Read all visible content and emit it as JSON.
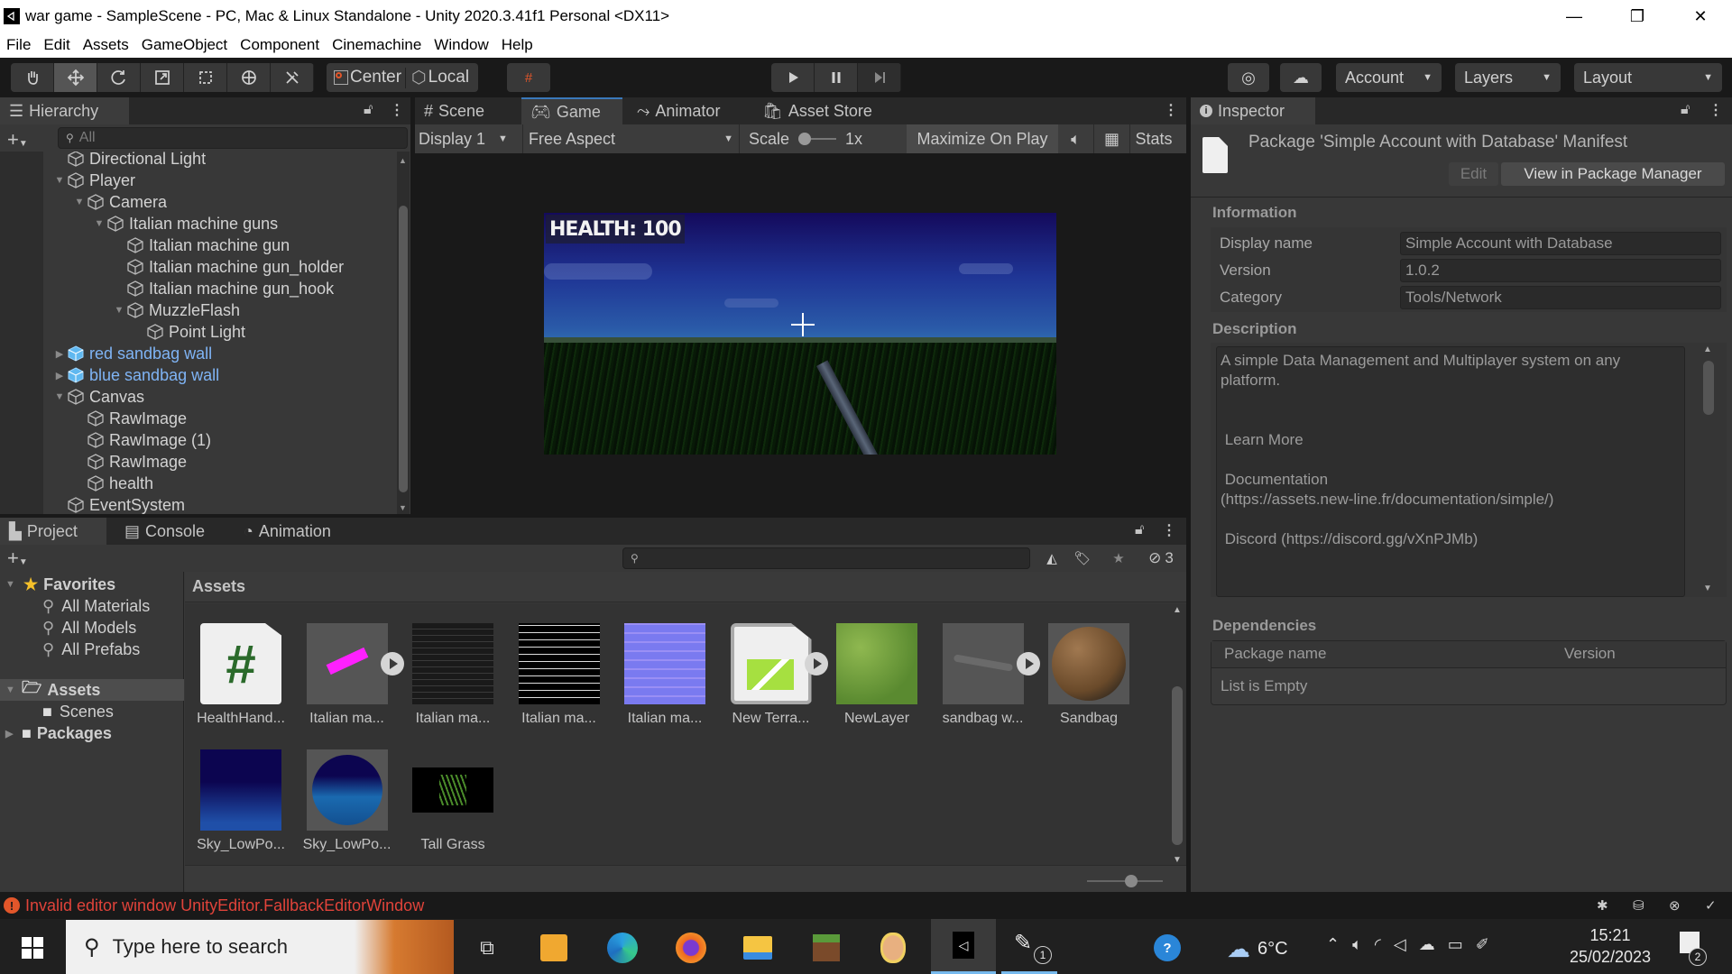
{
  "window": {
    "title": "war game - SampleScene - PC, Mac & Linux Standalone - Unity 2020.3.41f1 Personal <DX11>",
    "minimize": "—",
    "restore": "❐",
    "close": "✕"
  },
  "menu": [
    "File",
    "Edit",
    "Assets",
    "GameObject",
    "Component",
    "Cinemachine",
    "Window",
    "Help"
  ],
  "toolbar": {
    "tools": [
      "hand-tool",
      "move-tool",
      "rotate-tool",
      "scale-tool",
      "rect-tool",
      "transform-tool",
      "custom-tool"
    ],
    "active_tool": "move-tool",
    "pivot_label": "Center",
    "space_label": "Local",
    "account_label": "Account",
    "layers_label": "Layers",
    "layout_label": "Layout"
  },
  "hierarchy": {
    "tab_label": "Hierarchy",
    "search_placeholder": "All",
    "items": [
      {
        "label": "Directional Light",
        "depth": 1,
        "arrow": "",
        "prefab": false
      },
      {
        "label": "Player",
        "depth": 1,
        "arrow": "down",
        "prefab": false
      },
      {
        "label": "Camera",
        "depth": 2,
        "arrow": "down",
        "prefab": false
      },
      {
        "label": "Italian machine guns",
        "depth": 3,
        "arrow": "down",
        "prefab": false
      },
      {
        "label": "Italian machine gun",
        "depth": 4,
        "arrow": "",
        "prefab": false
      },
      {
        "label": "Italian machine gun_holder",
        "depth": 4,
        "arrow": "",
        "prefab": false
      },
      {
        "label": "Italian machine gun_hook",
        "depth": 4,
        "arrow": "",
        "prefab": false
      },
      {
        "label": "MuzzleFlash",
        "depth": 4,
        "arrow": "down",
        "prefab": false
      },
      {
        "label": "Point Light",
        "depth": 5,
        "arrow": "",
        "prefab": false
      },
      {
        "label": "red sandbag wall",
        "depth": 1,
        "arrow": "right",
        "prefab": true
      },
      {
        "label": "blue sandbag wall",
        "depth": 1,
        "arrow": "right",
        "prefab": true
      },
      {
        "label": "Canvas",
        "depth": 1,
        "arrow": "down",
        "prefab": false
      },
      {
        "label": "RawImage",
        "depth": 2,
        "arrow": "",
        "prefab": false
      },
      {
        "label": "RawImage (1)",
        "depth": 2,
        "arrow": "",
        "prefab": false
      },
      {
        "label": "RawImage",
        "depth": 2,
        "arrow": "",
        "prefab": false
      },
      {
        "label": "health",
        "depth": 2,
        "arrow": "",
        "prefab": false
      },
      {
        "label": "EventSystem",
        "depth": 1,
        "arrow": "",
        "prefab": false
      }
    ]
  },
  "center_tabs": {
    "scene": "Scene",
    "game": "Game",
    "animator": "Animator",
    "asset_store": "Asset Store",
    "active": "Game"
  },
  "game_bar": {
    "display": "Display 1",
    "aspect": "Free Aspect",
    "scale_label": "Scale",
    "scale_value": "1x",
    "maximize": "Maximize On Play",
    "stats": "Stats"
  },
  "game_view": {
    "health_text": "HEALTH: 100"
  },
  "inspector": {
    "tab_label": "Inspector",
    "title": "Package 'Simple Account with Database' Manifest",
    "edit_button": "Edit",
    "view_button": "View in Package Manager",
    "information_header": "Information",
    "fields": [
      {
        "label": "Display name",
        "value": "Simple Account with Database"
      },
      {
        "label": "Version",
        "value": "1.0.2"
      },
      {
        "label": "Category",
        "value": "Tools/Network"
      }
    ],
    "description_header": "Description",
    "description_lines": [
      "A simple Data Management and Multiplayer system on any",
      "platform.",
      "",
      "",
      " Learn More",
      "",
      " Documentation",
      "(https://assets.new-line.fr/documentation/simple/)",
      "",
      " Discord (https://discord.gg/vXnPJMb)"
    ],
    "dependencies_header": "Dependencies",
    "dep_col_name": "Package name",
    "dep_col_version": "Version",
    "dep_empty": "List is Empty"
  },
  "bottom_tabs": {
    "project": "Project",
    "console": "Console",
    "animation": "Animation",
    "active": "Project"
  },
  "project": {
    "search_placeholder": "",
    "hidden_count": "3",
    "favorites_label": "Favorites",
    "favorites": [
      "All Materials",
      "All Models",
      "All Prefabs"
    ],
    "assets_label": "Assets",
    "asset_children": [
      "Scenes"
    ],
    "packages_label": "Packages",
    "breadcrumb": "Assets",
    "assets": [
      {
        "name": "HealthHand...",
        "kind": "script",
        "has_children": false
      },
      {
        "name": "Italian ma...",
        "kind": "model",
        "has_children": true
      },
      {
        "name": "Italian ma...",
        "kind": "texture-dark",
        "has_children": false
      },
      {
        "name": "Italian ma...",
        "kind": "texture-bw",
        "has_children": false
      },
      {
        "name": "Italian ma...",
        "kind": "normal-map",
        "has_children": false
      },
      {
        "name": "New Terra...",
        "kind": "terrain",
        "has_children": true
      },
      {
        "name": "NewLayer",
        "kind": "grass-layer",
        "has_children": false
      },
      {
        "name": "sandbag w...",
        "kind": "model-grey",
        "has_children": true
      },
      {
        "name": "Sandbag",
        "kind": "material-sphere",
        "has_children": false
      },
      {
        "name": "Sky_LowPo...",
        "kind": "sky-texture",
        "has_children": false
      },
      {
        "name": "Sky_LowPo...",
        "kind": "sky-material",
        "has_children": false
      },
      {
        "name": "Tall Grass",
        "kind": "grass-texture",
        "has_children": false
      }
    ],
    "icon_size_slider": 0.6
  },
  "status": {
    "error_text": "Invalid editor window UnityEditor.FallbackEditorWindow",
    "error_color": "#e0433a"
  },
  "taskbar": {
    "search_placeholder": "Type here to search",
    "weather": "6°C",
    "time": "15:21",
    "date": "25/02/2023",
    "notifications": "2",
    "pen_badge": "1"
  },
  "colors": {
    "accent": "#3a79bb",
    "prefab": "#7fb4f5",
    "panel": "#383838",
    "dark": "#191919"
  }
}
